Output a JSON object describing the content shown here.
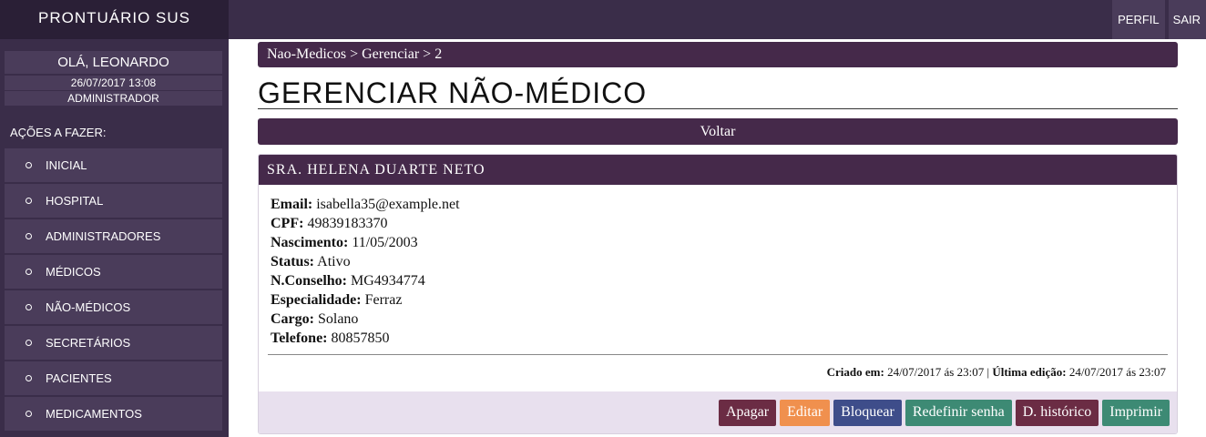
{
  "app": {
    "title": "PRONTUÁRIO SUS"
  },
  "topnav": {
    "perfil": "PERFIL",
    "sair": "SAIR"
  },
  "user": {
    "greeting": "OLÁ, LEONARDO",
    "datetime": "26/07/2017 13:08",
    "role": "ADMINISTRADOR"
  },
  "sidebar": {
    "actions_title": "AÇÕES A FAZER:",
    "items": [
      {
        "label": "INICIAL"
      },
      {
        "label": "HOSPITAL"
      },
      {
        "label": "ADMINISTRADORES"
      },
      {
        "label": "MÉDICOS"
      },
      {
        "label": "NÃO-MÉDICOS"
      },
      {
        "label": "SECRETÁRIOS"
      },
      {
        "label": "PACIENTES"
      },
      {
        "label": "MEDICAMENTOS"
      }
    ]
  },
  "breadcrumb": "Nao-Medicos > Gerenciar > 2",
  "page_title": "GERENCIAR NÃO-MÉDICO",
  "back_label": "Voltar",
  "card": {
    "title": "SRA. HELENA DUARTE NETO",
    "fields": [
      {
        "label": "Email:",
        "value": "isabella35@example.net"
      },
      {
        "label": "CPF:",
        "value": "49839183370"
      },
      {
        "label": "Nascimento:",
        "value": "11/05/2003"
      },
      {
        "label": "Status:",
        "value": "Ativo"
      },
      {
        "label": "N.Conselho:",
        "value": "MG4934774"
      },
      {
        "label": "Especialidade:",
        "value": "Ferraz"
      },
      {
        "label": "Cargo:",
        "value": "Solano"
      },
      {
        "label": "Telefone:",
        "value": "80857850"
      }
    ],
    "meta": {
      "created_label": "Criado em:",
      "created_value": "24/07/2017 ás 23:07",
      "separator": "|",
      "edited_label": "Última edição:",
      "edited_value": "24/07/2017 ás 23:07"
    },
    "buttons": {
      "apagar": "Apagar",
      "editar": "Editar",
      "bloquear": "Bloquear",
      "redefinir": "Redefinir senha",
      "historico": "D. histórico",
      "imprimir": "Imprimir"
    }
  }
}
